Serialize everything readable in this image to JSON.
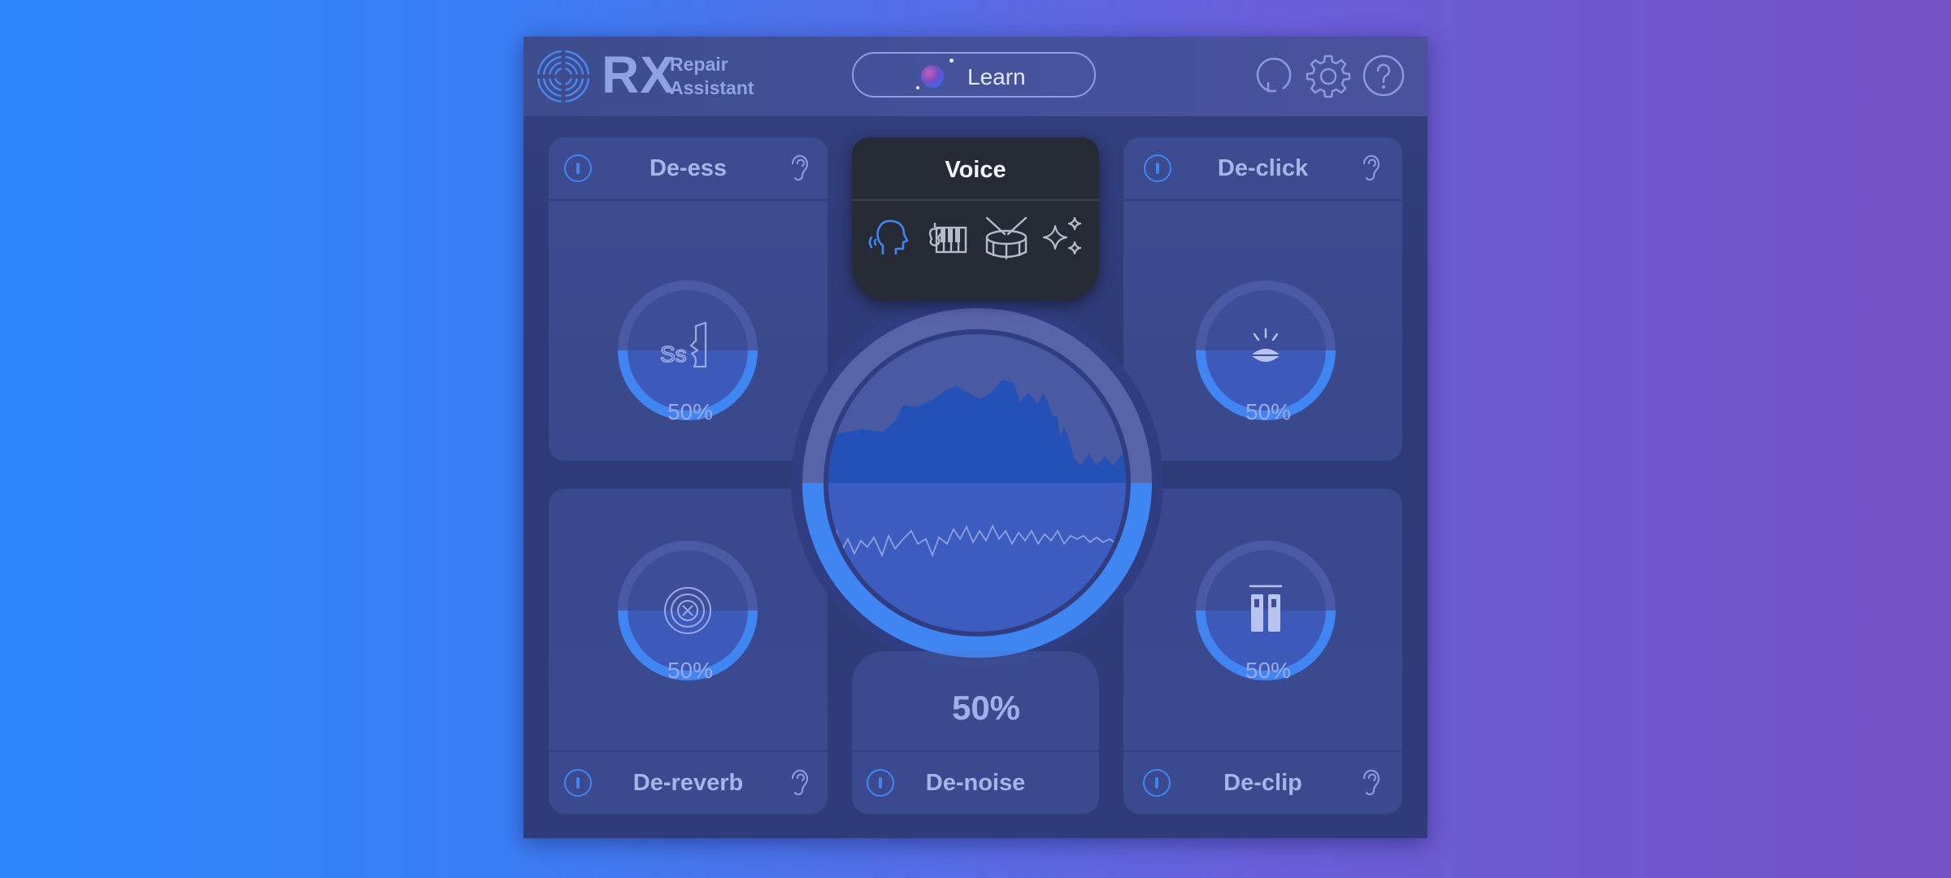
{
  "app": {
    "logo_text": "RX",
    "logo_sub_line1": "Repair",
    "logo_sub_line2": "Assistant"
  },
  "header": {
    "learn_label": "Learn",
    "icons": [
      "undo-icon",
      "gear-icon",
      "help-icon"
    ]
  },
  "voice_panel": {
    "title": "Voice",
    "modes": [
      "voice-mode-icon",
      "instrument-mode-icon",
      "drum-mode-icon",
      "magic-mode-icon"
    ],
    "selected_mode": "voice-mode-icon"
  },
  "modules": {
    "de_ess": {
      "title": "De-ess",
      "amount": "50%",
      "fill": 0.5
    },
    "de_click": {
      "title": "De-click",
      "amount": "50%",
      "fill": 0.5
    },
    "de_reverb": {
      "title": "De-reverb",
      "amount": "50%",
      "fill": 0.5
    },
    "de_clip": {
      "title": "De-clip",
      "amount": "50%",
      "fill": 0.5
    },
    "de_noise": {
      "title": "De-noise",
      "amount": "50%",
      "fill": 0.5
    }
  },
  "colors": {
    "accent": "#3f86f2",
    "voice_panel_bg": "#262a35",
    "text": "#a8b4e8"
  }
}
